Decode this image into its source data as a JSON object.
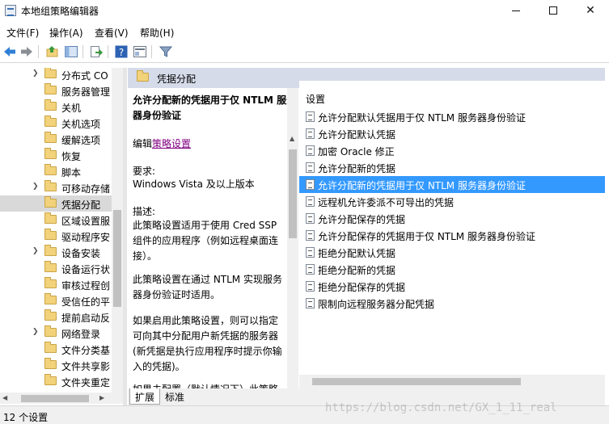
{
  "window": {
    "title": "本地组策略编辑器",
    "controls": {
      "minimize": "—",
      "maximize": "☐",
      "close": "✕"
    }
  },
  "menu": [
    "文件(F)",
    "操作(A)",
    "查看(V)",
    "帮助(H)"
  ],
  "toolbar_icons": [
    "back-arrow-icon",
    "forward-arrow-icon",
    "up-folder-icon",
    "show-hide-tree-icon",
    "export-list-icon",
    "help-icon",
    "properties-icon",
    "filter-icon"
  ],
  "tree": {
    "items": [
      {
        "label": "分布式 CO",
        "expandable": true
      },
      {
        "label": "服务器管理",
        "expandable": false
      },
      {
        "label": "关机",
        "expandable": false
      },
      {
        "label": "关机选项",
        "expandable": false
      },
      {
        "label": "缓解选项",
        "expandable": false
      },
      {
        "label": "恢复",
        "expandable": false
      },
      {
        "label": "脚本",
        "expandable": false
      },
      {
        "label": "可移动存储",
        "expandable": true
      },
      {
        "label": "凭据分配",
        "expandable": false,
        "selected": true
      },
      {
        "label": "区域设置服",
        "expandable": false
      },
      {
        "label": "驱动程序安",
        "expandable": false
      },
      {
        "label": "设备安装",
        "expandable": true
      },
      {
        "label": "设备运行状",
        "expandable": false
      },
      {
        "label": "审核过程创",
        "expandable": false
      },
      {
        "label": "受信任的平",
        "expandable": false
      },
      {
        "label": "提前启动反",
        "expandable": false
      },
      {
        "label": "网络登录",
        "expandable": true
      },
      {
        "label": "文件分类基",
        "expandable": false
      },
      {
        "label": "文件共享影",
        "expandable": false
      },
      {
        "label": "文件夹重定",
        "expandable": false
      }
    ]
  },
  "right": {
    "header": "凭据分配",
    "description": {
      "title": "允许分配新的凭据用于仅 NTLM 服务器身份验证",
      "edit_prefix": "编辑",
      "edit_link": "策略设置",
      "req_label": "要求:",
      "req_value": "Windows Vista 及以上版本",
      "desc_label": "描述:",
      "desc_1": "此策略设置适用于使用 Cred SSP 组件的应用程序（例如远程桌面连接）。",
      "desc_2": "此策略设置在通过 NTLM 实现服务器身份验证时适用。",
      "desc_3": "如果启用此策略设置，则可以指定可向其中分配用户新凭据的服务器(新凭据是执行应用程序时提示你输入的凭据)。",
      "desc_4": "如果未配置（默认情况下）此策略"
    },
    "settings_header": "设置",
    "settings": [
      {
        "label": "允许分配默认凭据用于仅 NTLM 服务器身份验证"
      },
      {
        "label": "允许分配默认凭据"
      },
      {
        "label": "加密 Oracle 修正"
      },
      {
        "label": "允许分配新的凭据"
      },
      {
        "label": "允许分配新的凭据用于仅 NTLM 服务器身份验证",
        "selected": true
      },
      {
        "label": "远程机允许委派不可导出的凭据"
      },
      {
        "label": "允许分配保存的凭据"
      },
      {
        "label": "允许分配保存的凭据用于仅 NTLM 服务器身份验证"
      },
      {
        "label": "拒绝分配默认凭据"
      },
      {
        "label": "拒绝分配新的凭据"
      },
      {
        "label": "拒绝分配保存的凭据"
      },
      {
        "label": "限制向远程服务器分配凭据"
      }
    ],
    "tabs": [
      "扩展",
      "标准"
    ]
  },
  "status": "12 个设置",
  "watermark": "https://blog.csdn.net/GX_1_11_real",
  "colors": {
    "selection": "#3399ff",
    "header_band": "#d6dbe9",
    "tree_selection": "#d9d9d9",
    "link": "#800080"
  }
}
